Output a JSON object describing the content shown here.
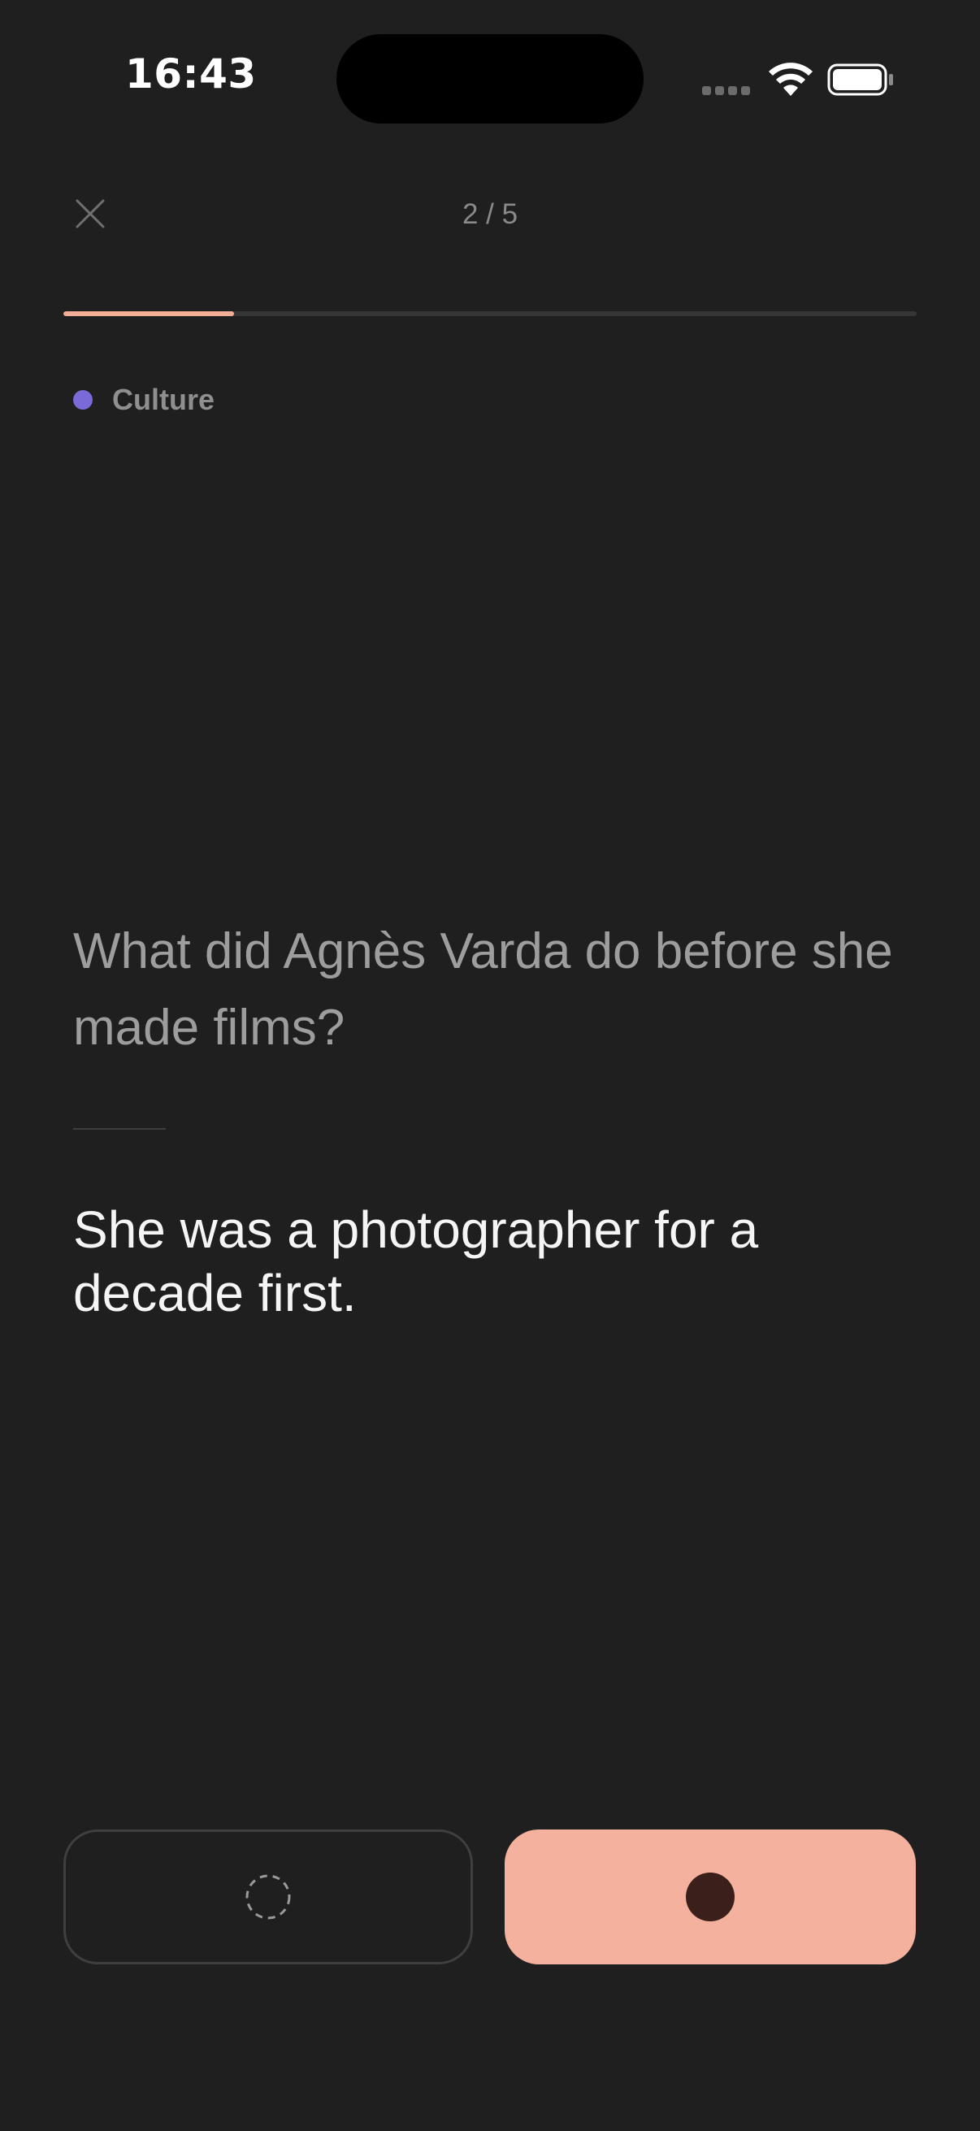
{
  "status_bar": {
    "time": "16:43",
    "icons": [
      "cellular-signal-icon",
      "wifi-icon",
      "battery-icon"
    ]
  },
  "header": {
    "close_icon": "close-icon",
    "counter": "2 / 5",
    "progress": {
      "current": 2,
      "total": 5,
      "fill_fraction": 0.2
    }
  },
  "card": {
    "category": {
      "label": "Culture",
      "color": "#7a6ad8"
    },
    "question": "What did Agnès Varda do before she made films?",
    "answer": "She was a photographer for a decade first."
  },
  "actions": {
    "left_button": {
      "icon": "dashed-circle-icon"
    },
    "right_button": {
      "icon": "record-dot-icon",
      "color": "#f4b19d"
    }
  },
  "colors": {
    "background": "#1f1f1f",
    "accent": "#f4ae98"
  }
}
